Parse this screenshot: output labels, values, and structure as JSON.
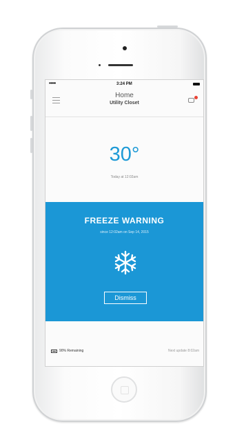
{
  "status_bar": {
    "signal": "•••••",
    "time": "3:24 PM"
  },
  "nav": {
    "title": "Home",
    "subtitle": "Utility Closet",
    "menu_icon": "hamburger-icon",
    "chat_icon": "chat-bubble-icon"
  },
  "temperature": {
    "value": "30°",
    "updated": "Today at 12:02am"
  },
  "warning": {
    "title": "FREEZE WARNING",
    "since": "since 12:02am on Sep 14, 2015",
    "icon": "snowflake-icon",
    "dismiss_label": "Dismiss",
    "background": "#1b97d6"
  },
  "footer": {
    "battery": "90% Remaining",
    "next_update": "Next update 8:02am"
  },
  "colors": {
    "accent": "#1e9ad6",
    "badge": "#e94335"
  }
}
